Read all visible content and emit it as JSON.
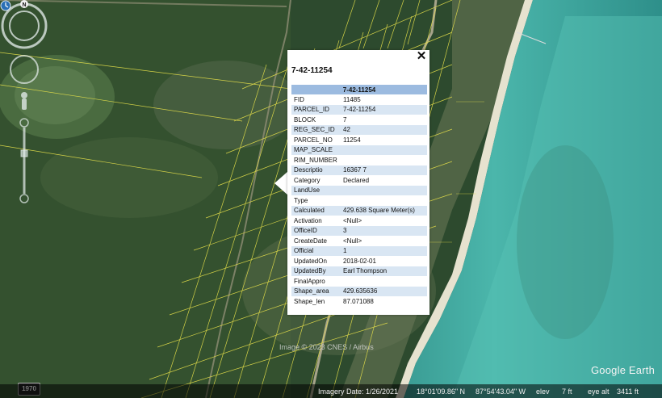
{
  "popup": {
    "title": "7-42-11254",
    "table_header": "7-42-11254",
    "close_label": "✕",
    "rows": [
      {
        "key": "FID",
        "value": "11485"
      },
      {
        "key": "PARCEL_ID",
        "value": "7-42-11254"
      },
      {
        "key": "BLOCK",
        "value": "7"
      },
      {
        "key": "REG_SEC_ID",
        "value": "42"
      },
      {
        "key": "PARCEL_NO",
        "value": "11254"
      },
      {
        "key": "MAP_SCALE",
        "value": ""
      },
      {
        "key": "RIM_NUMBER",
        "value": ""
      },
      {
        "key": "Descriptio",
        "value": "16367 7"
      },
      {
        "key": "Category",
        "value": "Declared"
      },
      {
        "key": "LandUse",
        "value": ""
      },
      {
        "key": "Type",
        "value": ""
      },
      {
        "key": "Calculated",
        "value": "429.638 Square Meter(s)"
      },
      {
        "key": "Activation",
        "value": "<Null>"
      },
      {
        "key": "OfficeID",
        "value": "3"
      },
      {
        "key": "CreateDate",
        "value": "<Null>"
      },
      {
        "key": "Official",
        "value": "1"
      },
      {
        "key": "UpdatedOn",
        "value": "2018-02-01"
      },
      {
        "key": "UpdatedBy",
        "value": "Earl Thompson"
      },
      {
        "key": "FinalAppro",
        "value": ""
      },
      {
        "key": "Shape_area",
        "value": "429.635636"
      },
      {
        "key": "Shape_len",
        "value": "87.071088"
      }
    ]
  },
  "map": {
    "attribution": "Image © 2023 CNES / Airbus",
    "brand": "Google Earth",
    "timeline_year": "1970",
    "compass_north": "N",
    "colors": {
      "parcel_lines": "#e6e04a",
      "table_header": "#9cbbe0",
      "table_alt_row": "#d9e6f3"
    }
  },
  "status": {
    "imagery_date": "Imagery Date: 1/26/2021",
    "latitude": "18°01'09.86\" N",
    "longitude": "87°54'43.04\" W",
    "elev_label": "elev",
    "elev_value": "7 ft",
    "eye_alt_label": "eye alt",
    "eye_alt_value": "3411 ft"
  }
}
